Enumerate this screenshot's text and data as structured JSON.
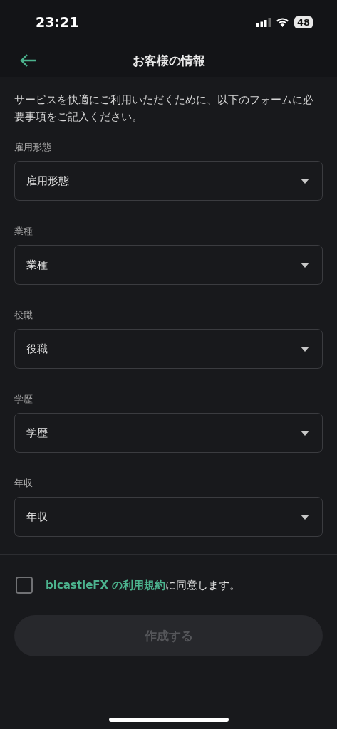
{
  "status_bar": {
    "time": "23:21",
    "battery": "48"
  },
  "header": {
    "title": "お客様の情報"
  },
  "intro": "サービスを快適にご利用いただくために、以下のフォームに必要事項をご記入ください。",
  "fields": [
    {
      "label": "雇用形態",
      "placeholder": "雇用形態"
    },
    {
      "label": "業種",
      "placeholder": "業種"
    },
    {
      "label": "役職",
      "placeholder": "役職"
    },
    {
      "label": "学歴",
      "placeholder": "学歴"
    },
    {
      "label": "年収",
      "placeholder": "年収"
    }
  ],
  "agreement": {
    "checked": false,
    "link": "bicastleFX の利用規約",
    "text": "に同意します。"
  },
  "submit": {
    "label": "作成する",
    "disabled": true
  }
}
